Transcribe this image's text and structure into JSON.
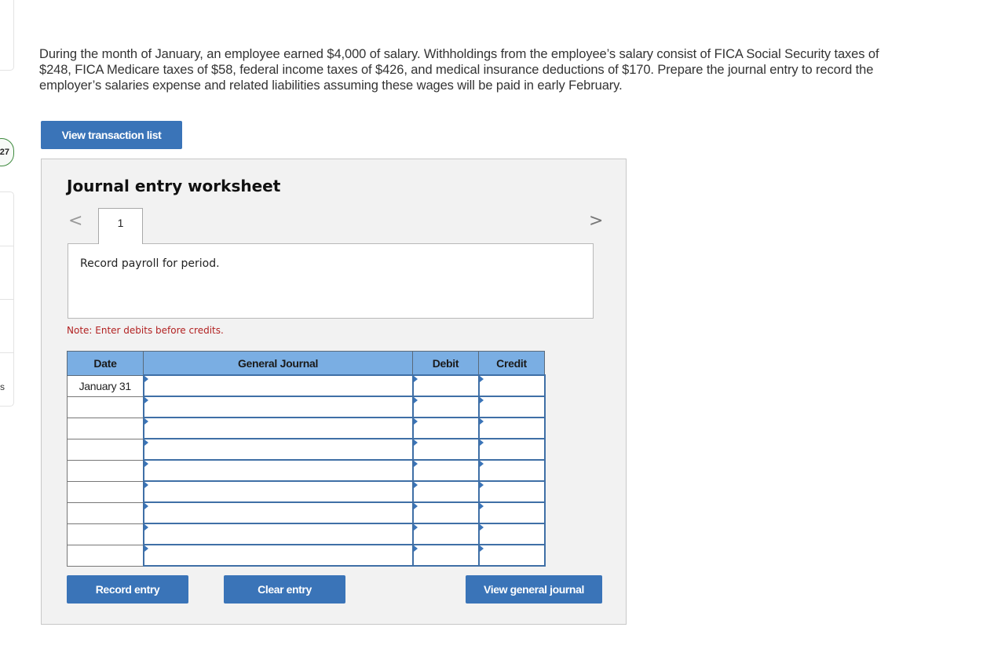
{
  "sidebar": {
    "badge_number": "27",
    "partial_label": "s"
  },
  "question": {
    "text": "During the month of January, an employee earned $4,000 of salary. Withholdings from the employee’s salary consist of FICA Social Security taxes of $248, FICA Medicare taxes of $58, federal income taxes of $426, and medical insurance deductions of $170. Prepare the journal entry to record the employer’s salaries expense and related liabilities assuming these wages will be paid in early February."
  },
  "buttons": {
    "view_transaction_list": "View transaction list",
    "record_entry": "Record entry",
    "clear_entry": "Clear entry",
    "view_general_journal": "View general journal"
  },
  "worksheet": {
    "title": "Journal entry worksheet",
    "prev_glyph": "<",
    "next_glyph": ">",
    "current_tab": "1",
    "description": "Record payroll for period.",
    "note": "Note: Enter debits before credits."
  },
  "journal": {
    "headers": [
      "Date",
      "General Journal",
      "Debit",
      "Credit"
    ],
    "rows": [
      {
        "date": "January 31",
        "account": "",
        "debit": "",
        "credit": ""
      },
      {
        "date": "",
        "account": "",
        "debit": "",
        "credit": ""
      },
      {
        "date": "",
        "account": "",
        "debit": "",
        "credit": ""
      },
      {
        "date": "",
        "account": "",
        "debit": "",
        "credit": ""
      },
      {
        "date": "",
        "account": "",
        "debit": "",
        "credit": ""
      },
      {
        "date": "",
        "account": "",
        "debit": "",
        "credit": ""
      },
      {
        "date": "",
        "account": "",
        "debit": "",
        "credit": ""
      },
      {
        "date": "",
        "account": "",
        "debit": "",
        "credit": ""
      },
      {
        "date": "",
        "account": "",
        "debit": "",
        "credit": ""
      }
    ]
  },
  "colors": {
    "button_blue": "#3a74b8",
    "header_blue": "#7aaee3",
    "note_red": "#b22222",
    "badge_green": "#3e8a3e"
  }
}
